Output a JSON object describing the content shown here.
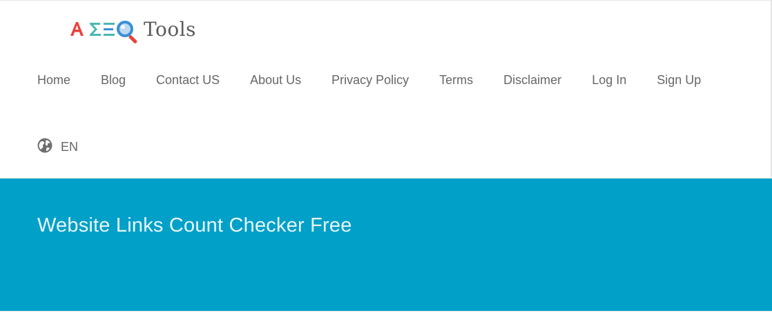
{
  "logo": {
    "text": "Tools",
    "mark_text": "A SEO",
    "colors": {
      "red": "#e8413b",
      "teal": "#4ab8b2",
      "blue": "#3a8fd6",
      "text": "#5a5a5a"
    }
  },
  "nav": {
    "items": [
      {
        "label": "Home"
      },
      {
        "label": "Blog"
      },
      {
        "label": "Contact US"
      },
      {
        "label": "About Us"
      },
      {
        "label": "Privacy Policy"
      },
      {
        "label": "Terms"
      },
      {
        "label": "Disclaimer"
      },
      {
        "label": "Log In"
      },
      {
        "label": "Sign Up"
      }
    ]
  },
  "language": {
    "label": "EN",
    "icon": "globe-icon"
  },
  "banner": {
    "title": "Website Links Count Checker Free",
    "background": "#00a0c8"
  }
}
